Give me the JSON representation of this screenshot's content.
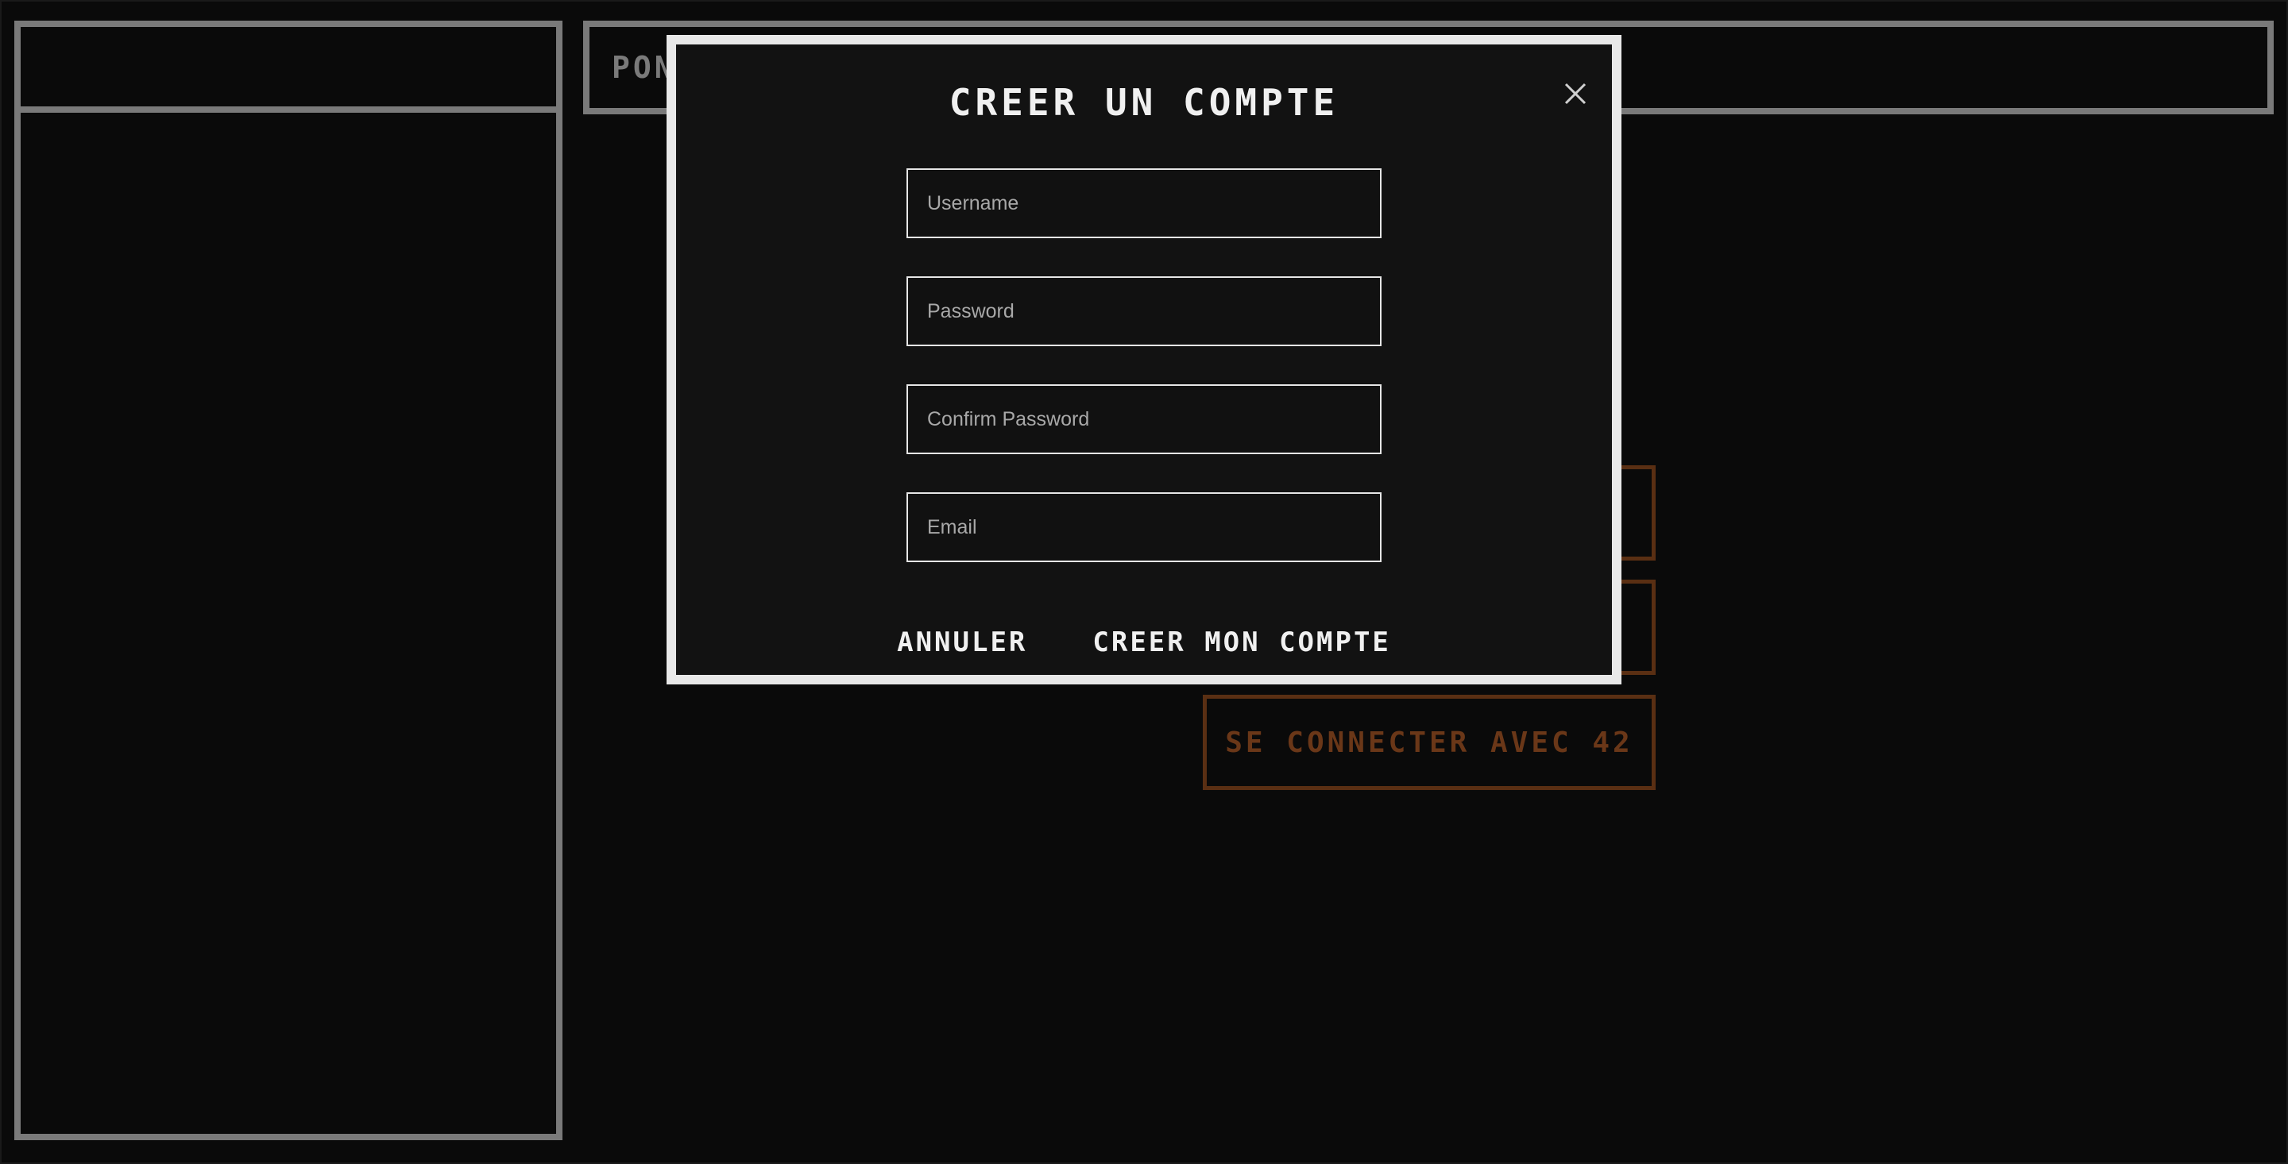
{
  "header": {
    "title": "PON"
  },
  "auth_buttons": [
    {
      "label": ""
    },
    {
      "label": ""
    },
    {
      "label": "SE CONNECTER AVEC 42"
    }
  ],
  "modal": {
    "title": "CREER UN COMPTE",
    "close_icon": "close-icon",
    "fields": {
      "username_placeholder": "Username",
      "password_placeholder": "Password",
      "confirm_password_placeholder": "Confirm Password",
      "email_placeholder": "Email"
    },
    "cancel_label": "ANNULER",
    "submit_label": "CREER MON COMPTE"
  },
  "colors": {
    "background": "#0a0a0a",
    "frame_gray": "#7a7a7a",
    "modal_border": "#e8e8e8",
    "modal_bg": "#121212",
    "accent_brown": "#5a2f13"
  }
}
